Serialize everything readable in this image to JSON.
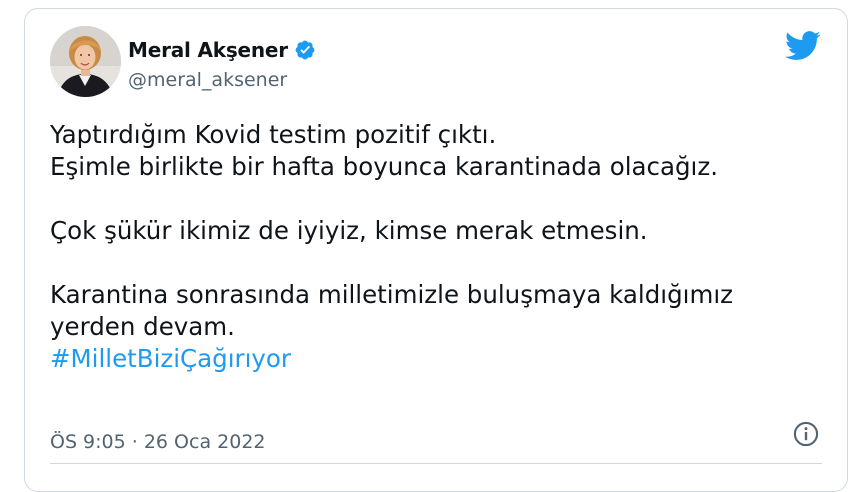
{
  "author": {
    "display_name": "Meral Akşener",
    "handle": "@meral_aksener",
    "verified": true
  },
  "tweet": {
    "paragraphs": [
      [
        "Yaptırdığım Kovid testim pozitif çıktı.",
        "Eşimle birlikte bir hafta boyunca karantinada olacağız."
      ],
      [
        "Çok şükür ikimiz de iyiyiz, kimse merak etmesin."
      ],
      [
        "Karantina sonrasında milletimizle buluşmaya kaldığımız",
        "yerden devam."
      ]
    ],
    "hashtag": "#MilletBiziÇağırıyor",
    "timestamp": "ÖS 9:05 · 26 Oca 2022"
  },
  "icons": {
    "verified": "verified-badge-icon",
    "brand": "twitter-bird-icon",
    "info": "info-icon"
  },
  "colors": {
    "accent": "#1d9bf0",
    "text": "#0f1419",
    "muted": "#536471",
    "border": "#cfd9de"
  }
}
